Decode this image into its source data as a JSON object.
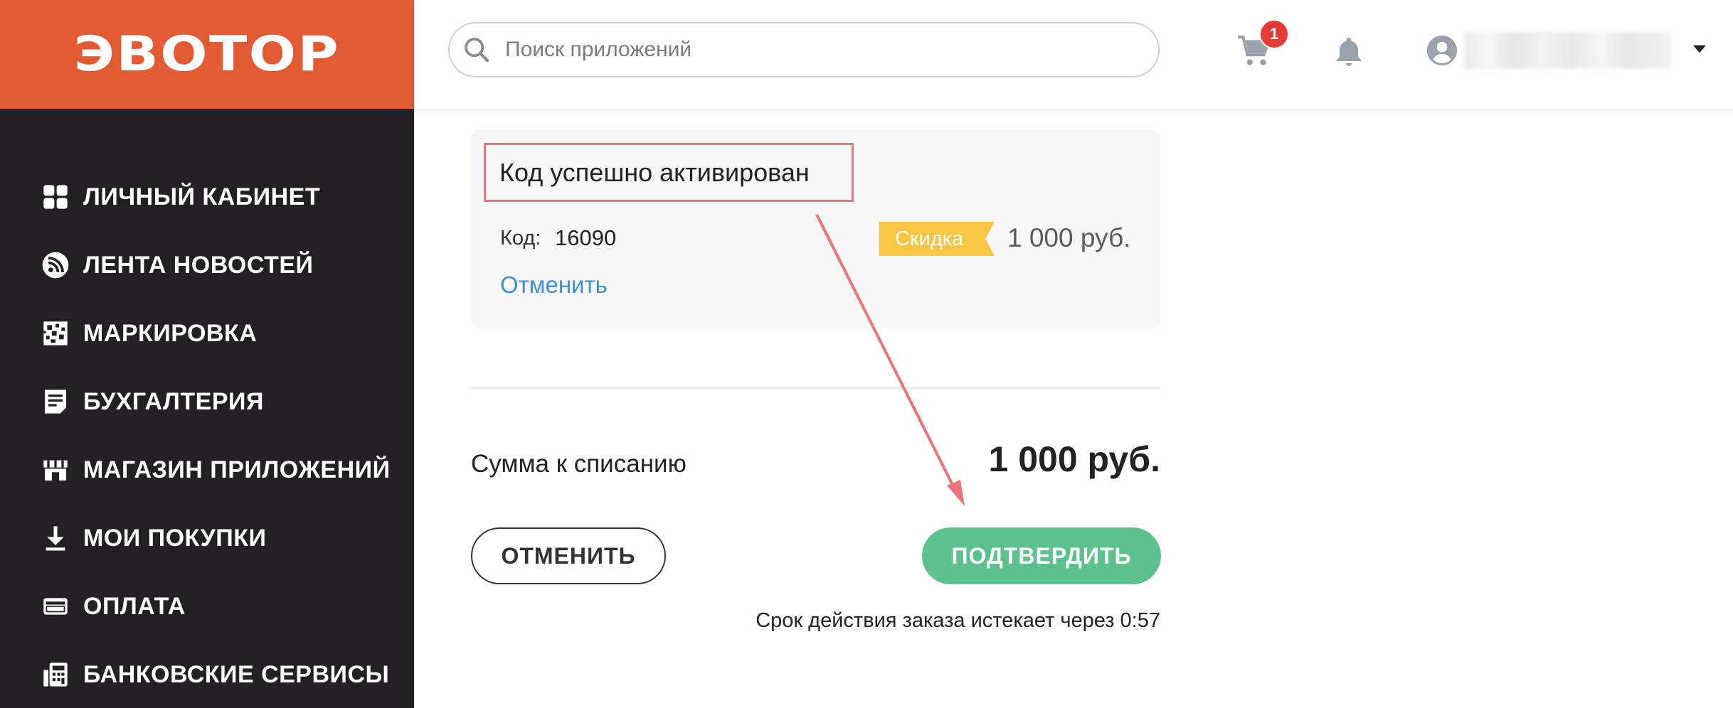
{
  "brand": {
    "logo_text": "ЭВОТОР",
    "color": "#e15a32"
  },
  "sidebar": {
    "items": [
      {
        "label": "ЛИЧНЫЙ КАБИНЕТ",
        "icon": "dashboard-icon"
      },
      {
        "label": "ЛЕНТА НОВОСТЕЙ",
        "icon": "rss-icon"
      },
      {
        "label": "МАРКИРОВКА",
        "icon": "datamatrix-icon"
      },
      {
        "label": "БУХГАЛТЕРИЯ",
        "icon": "document-icon"
      },
      {
        "label": "МАГАЗИН ПРИЛОЖЕНИЙ",
        "icon": "store-icon"
      },
      {
        "label": "МОИ ПОКУПКИ",
        "icon": "download-icon"
      },
      {
        "label": "ОПЛАТА",
        "icon": "credit-card-icon"
      },
      {
        "label": "БАНКОВСКИЕ СЕРВИСЫ",
        "icon": "bank-calculator-icon"
      }
    ]
  },
  "header": {
    "search_placeholder": "Поиск приложений",
    "cart_count": "1"
  },
  "promo": {
    "title": "Код успешно активирован",
    "code_label": "Код:",
    "code_value": "16090",
    "cancel_link": "Отменить",
    "discount_tag": "Скидка",
    "discount_amount": "1 000 руб."
  },
  "summary": {
    "total_label": "Сумма к списанию",
    "total_value": "1 000 руб."
  },
  "actions": {
    "cancel": "ОТМЕНИТЬ",
    "confirm": "ПОДТВЕРДИТЬ"
  },
  "expiry_text": "Срок действия заказа истекает через 0:57",
  "colors": {
    "accent": "#e15a32",
    "sidebar_bg": "#222022",
    "confirm": "#5cc18d",
    "link": "#3f8fdc",
    "discount_tag": "#f8c544",
    "annotation": "#e8757a"
  }
}
